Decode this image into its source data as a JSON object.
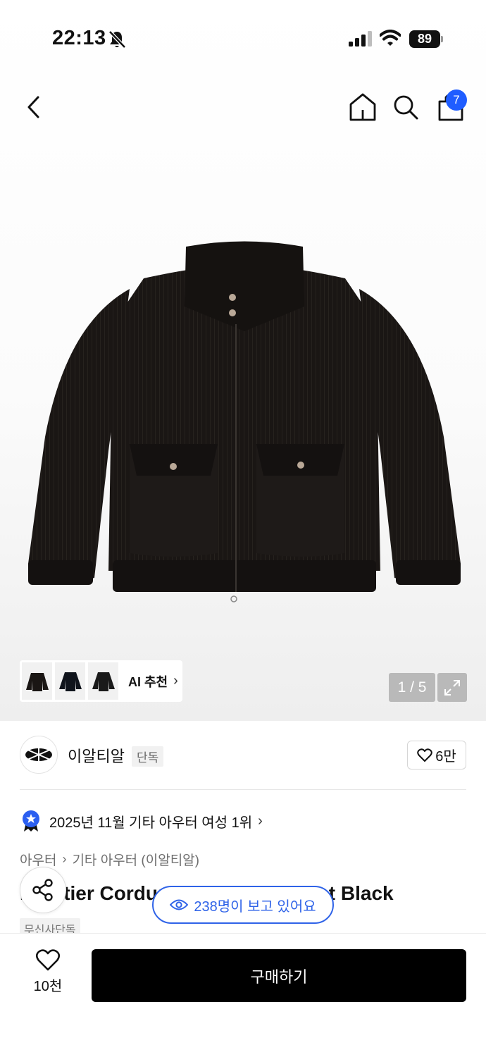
{
  "status_bar": {
    "time": "22:13",
    "battery": "89"
  },
  "header": {
    "cart_count": "7"
  },
  "gallery": {
    "ai_recommend_label": "AI 추천",
    "page_indicator": "1 / 5"
  },
  "brand": {
    "name": "이알티알",
    "tag": "단독",
    "like_count": "6만"
  },
  "ranking": {
    "text": "2025년 11월 기타 아우터 여성 1위"
  },
  "breadcrumb": {
    "category": "아우터",
    "subcategory": "기타 아우터 (이알티알)"
  },
  "product": {
    "title": "Frontier Corduroy Bomber Jacket Black",
    "exclusive_tag": "무신사단독"
  },
  "viewers": {
    "text": "238명이 보고 있어요"
  },
  "bottom_bar": {
    "wish_count": "10천",
    "buy_label": "구매하기"
  },
  "colors": {
    "accent": "#2f63e8",
    "badge": "#1f5dff",
    "buy_button": "#000000"
  }
}
